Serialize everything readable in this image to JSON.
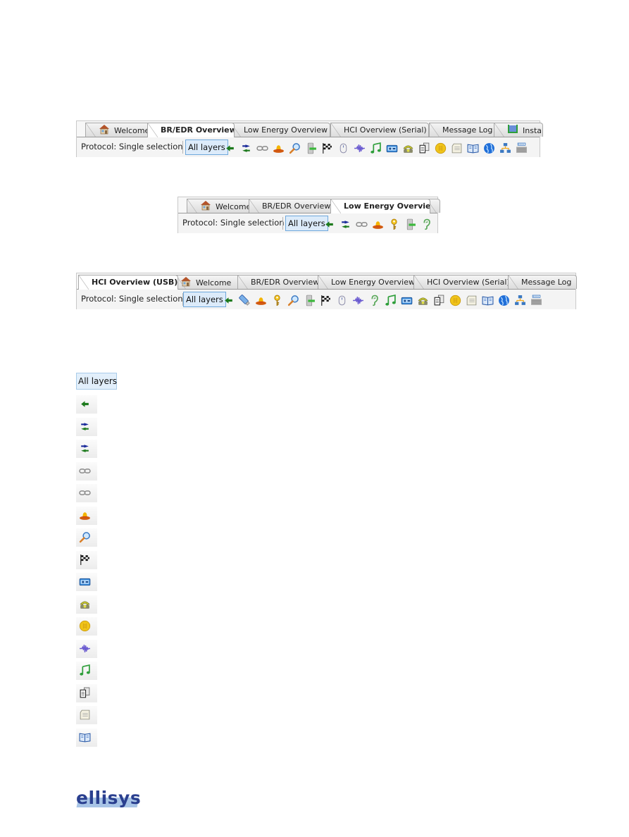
{
  "panels": [
    {
      "name": "br-edr-panel",
      "tabs": [
        {
          "label": "Welcome",
          "icon": "home-icon",
          "active": false
        },
        {
          "label": "BR/EDR Overview",
          "active": true
        },
        {
          "label": "Low Energy Overview",
          "active": false
        },
        {
          "label": "HCI Overview (Serial)",
          "active": false
        },
        {
          "label": "Message Log",
          "active": false
        },
        {
          "label": "Instan",
          "icon": "instant-timing-icon",
          "active": false
        }
      ],
      "protocol_label": "Protocol: Single selection",
      "all_layers_label": "All layers",
      "icons": [
        "arrow-left-icon",
        "bidirectional-arrows-icon",
        "link-chain-icon",
        "sombrero-icon",
        "magnifier-icon",
        "device-exchange-icon",
        "checkered-flag-icon",
        "mouse-icon",
        "waveform-icon",
        "music-note-icon",
        "radio-icon",
        "telephone-icon",
        "files-icon",
        "coin-icon",
        "document-icon",
        "book-icon",
        "globe-icon",
        "network-icon",
        "printer-icon"
      ]
    },
    {
      "name": "low-energy-panel",
      "tabs": [
        {
          "label": "Welcome",
          "icon": "home-icon",
          "active": false
        },
        {
          "label": "BR/EDR Overview",
          "active": false
        },
        {
          "label": "Low Energy Overview",
          "active": true
        },
        {
          "label": "",
          "active": false
        }
      ],
      "protocol_label": "Protocol: Single selection",
      "all_layers_label": "All layers",
      "icons": [
        "arrow-left-icon",
        "bidirectional-arrows-icon",
        "link-chain-icon",
        "sombrero-icon",
        "key-icon",
        "device-exchange-icon",
        "ear-icon"
      ]
    },
    {
      "name": "hci-usb-panel",
      "tabs": [
        {
          "label": "HCI Overview (USB)",
          "active": true
        },
        {
          "label": "Welcome",
          "icon": "home-icon",
          "active": false
        },
        {
          "label": "BR/EDR Overview",
          "active": false
        },
        {
          "label": "Low Energy Overview",
          "active": false
        },
        {
          "label": "HCI Overview (Serial)",
          "active": false
        },
        {
          "label": "Message Log",
          "active": false
        }
      ],
      "protocol_label": "Protocol: Single selection",
      "all_layers_label": "All layers",
      "icons": [
        "arrow-left-icon",
        "usb-stick-icon",
        "sombrero-icon",
        "key-icon",
        "magnifier-icon",
        "device-exchange-icon",
        "checkered-flag-icon",
        "mouse-icon",
        "waveform-icon",
        "ear-icon",
        "music-note-icon",
        "radio-icon",
        "telephone-icon",
        "files-icon",
        "coin-icon",
        "document-icon",
        "book-icon",
        "globe-icon",
        "network-icon",
        "printer-icon"
      ]
    }
  ],
  "legend": {
    "all_layers_label": "All layers",
    "icons": [
      "arrow-left-icon",
      "bidirectional-arrows-icon",
      "bidirectional-arrows-icon",
      "link-chain-icon",
      "link-chain-icon",
      "sombrero-icon",
      "magnifier-icon",
      "checkered-flag-icon",
      "radio-icon",
      "telephone-icon",
      "coin-icon",
      "waveform-icon",
      "music-note-icon",
      "files-icon",
      "document-icon",
      "book-icon"
    ]
  },
  "logo": {
    "text": "ellisys"
  }
}
